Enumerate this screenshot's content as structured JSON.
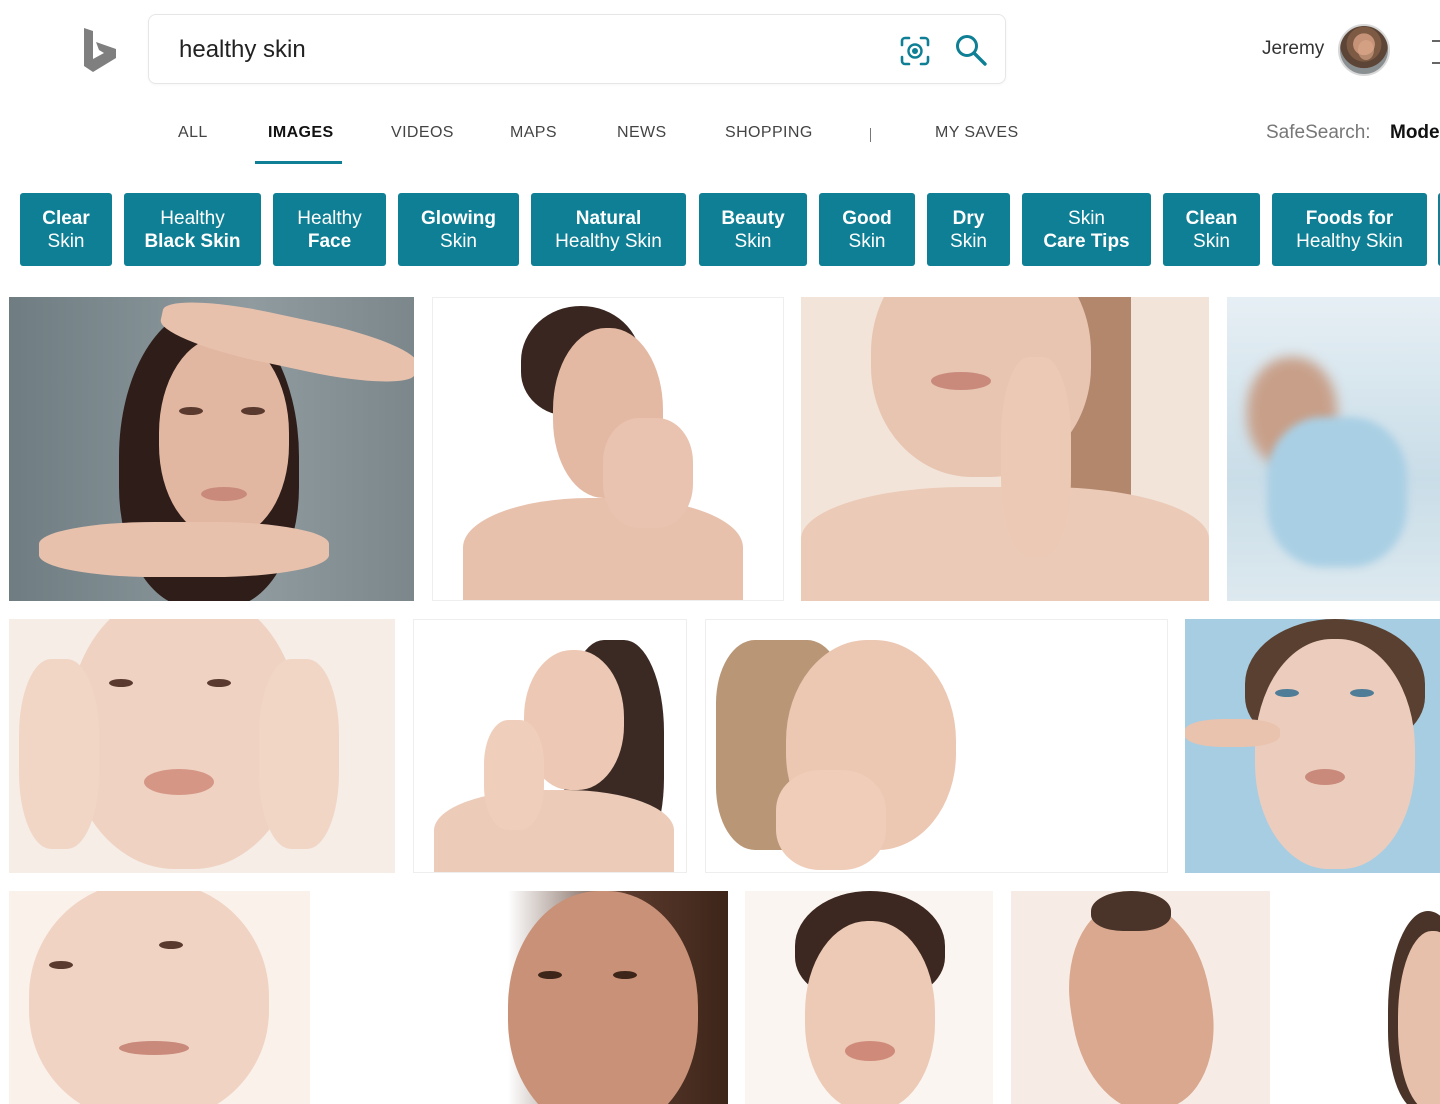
{
  "header": {
    "search_value": "healthy skin",
    "search_placeholder": "",
    "user_name": "Jeremy",
    "icons": {
      "logo": "bing-logo-icon",
      "visual_search": "visual-search-icon",
      "search": "search-icon"
    }
  },
  "tabs": {
    "items": [
      {
        "label": "ALL"
      },
      {
        "label": "IMAGES"
      },
      {
        "label": "VIDEOS"
      },
      {
        "label": "MAPS"
      },
      {
        "label": "NEWS"
      },
      {
        "label": "SHOPPING"
      },
      {
        "label": "MY SAVES"
      }
    ],
    "active": "IMAGES",
    "divider": "|",
    "safesearch_label": "SafeSearch:",
    "safesearch_value": "Mode"
  },
  "chips": [
    {
      "line1": "Clear",
      "line2": "Skin"
    },
    {
      "line1": "Healthy",
      "line2": "Black Skin"
    },
    {
      "line1": "Healthy",
      "line2": "Face"
    },
    {
      "line1": "Glowing",
      "line2": "Skin"
    },
    {
      "line1": "Natural",
      "line2": "Healthy Skin"
    },
    {
      "line1": "Beauty",
      "line2": "Skin"
    },
    {
      "line1": "Good",
      "line2": "Skin"
    },
    {
      "line1": "Dry",
      "line2": "Skin"
    },
    {
      "line1": "Skin",
      "line2": "Care Tips"
    },
    {
      "line1": "Clean",
      "line2": "Skin"
    },
    {
      "line1": "Foods for",
      "line2": "Healthy Skin"
    }
  ],
  "colors": {
    "accent": "#0e7f94",
    "skin": "#e8c1ad",
    "hair_dark": "#3a2620",
    "background_blue": "#a7cde3"
  }
}
